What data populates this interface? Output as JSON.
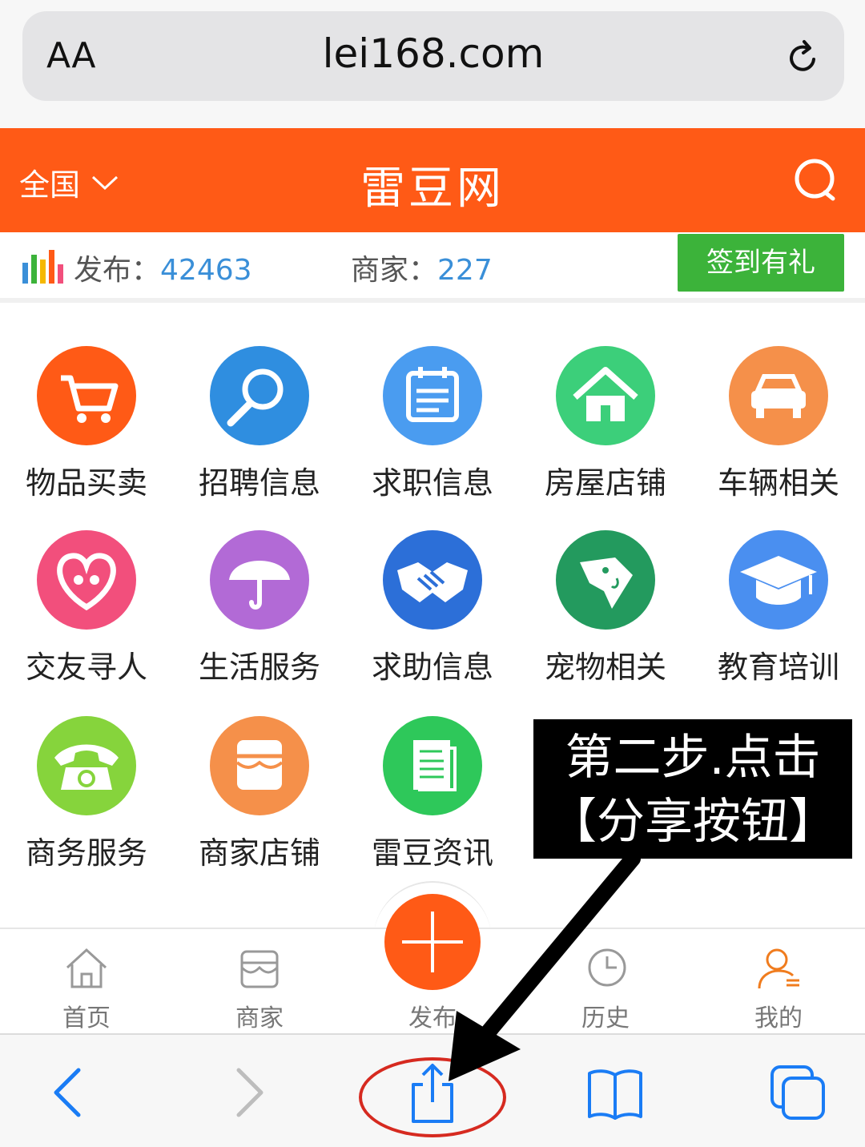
{
  "browser": {
    "aa_label": "AA",
    "url": "lei168.com"
  },
  "header": {
    "region": "全国",
    "title": "雷豆网"
  },
  "stats": {
    "publish_label": "发布：",
    "publish_value": "42463",
    "merchant_label": "商家：",
    "merchant_value": "227",
    "signin_label": "签到有礼"
  },
  "categories": [
    {
      "label": "物品买卖",
      "icon": "cart-icon",
      "color": "#ff5a16"
    },
    {
      "label": "招聘信息",
      "icon": "magnifier-icon",
      "color": "#2f8ee0"
    },
    {
      "label": "求职信息",
      "icon": "calendar-icon",
      "color": "#4a9cf0"
    },
    {
      "label": "房屋店铺",
      "icon": "house-icon",
      "color": "#3ccf7a"
    },
    {
      "label": "车辆相关",
      "icon": "car-icon",
      "color": "#f5904a"
    },
    {
      "label": "交友寻人",
      "icon": "heart-icon",
      "color": "#f24f7c"
    },
    {
      "label": "生活服务",
      "icon": "umbrella-icon",
      "color": "#b26ad6"
    },
    {
      "label": "求助信息",
      "icon": "handshake-icon",
      "color": "#2c6fd8"
    },
    {
      "label": "宠物相关",
      "icon": "dog-icon",
      "color": "#239a5e"
    },
    {
      "label": "教育培训",
      "icon": "graduation-cap-icon",
      "color": "#4a8ff0"
    },
    {
      "label": "商务服务",
      "icon": "telephone-icon",
      "color": "#86d43c"
    },
    {
      "label": "商家店铺",
      "icon": "storefront-icon",
      "color": "#f5904a"
    },
    {
      "label": "雷豆资讯",
      "icon": "news-icon",
      "color": "#2ec85a"
    }
  ],
  "annotation": {
    "line1": "第二步.点击",
    "line2": "【分享按钮】"
  },
  "tabbar": [
    {
      "label": "首页",
      "icon": "home-icon"
    },
    {
      "label": "商家",
      "icon": "store-icon"
    },
    {
      "label": "发布",
      "icon": "plus-icon"
    },
    {
      "label": "历史",
      "icon": "clock-icon"
    },
    {
      "label": "我的",
      "icon": "user-icon"
    }
  ],
  "colors": {
    "brand_orange": "#ff5a16",
    "signin_green": "#3cb33a",
    "stat_blue": "#3a8fd8",
    "ios_blue": "#1a7cf5",
    "highlight_red": "#d62a20"
  }
}
